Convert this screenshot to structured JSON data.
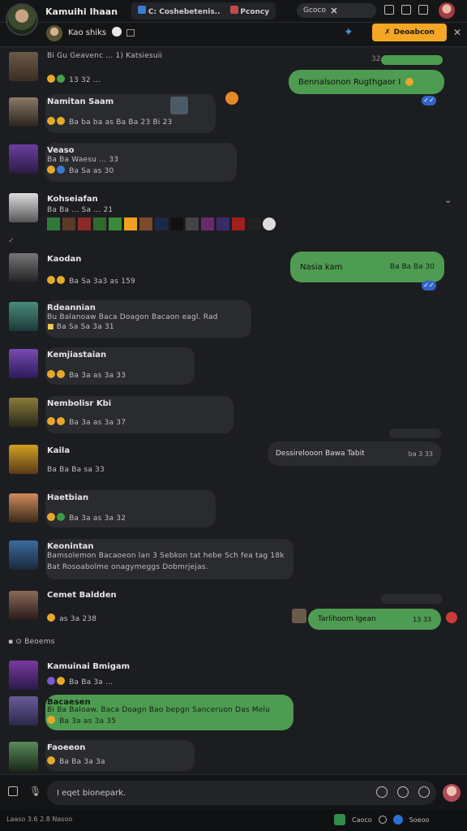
{
  "app": {
    "title": "Kamuihi Ihaan"
  },
  "tabs": [
    {
      "label": "C: Coshebetenis..",
      "icon": "folder-icon"
    },
    {
      "label": "Pconcy",
      "icon": "window-icon"
    }
  ],
  "search": {
    "label": "Gcoco"
  },
  "chat_header": {
    "name": "Kao shiks",
    "button_label": "Deoabcon"
  },
  "messages": [
    {
      "name": "",
      "subtitle": "Bi Gu Geavenc ... 1) Katsiesuii",
      "meta": "13 32 ..."
    },
    {
      "out_text": "Bennalsonon Rugthgaor I",
      "out_time": "32"
    },
    {
      "name": "Namitan Saam",
      "meta": "Ba ba ba as Ba Ba 23 Bi 23"
    },
    {
      "name": "Veaso",
      "subtitle": "Ba Ba Waesu ... 33",
      "meta": "Ba Sa as 30"
    },
    {
      "name": "Kohseiafan",
      "subtitle": "Ba Ba ... Sa ... 21"
    },
    {
      "name": "Kaodan",
      "meta": "Ba Sa 3a3 as 159"
    },
    {
      "out_text": "Nasia kam",
      "out_time": "Ba Ba Ba 30"
    },
    {
      "name": "Rdeannian",
      "subtitle": "Bu Balanoaw Baca Doagon Bacaon eagl. Rad",
      "meta": "Ba Sa Sa 3a 31"
    },
    {
      "name": "Kemjiastaian",
      "meta": "Ba 3a as 3a 33"
    },
    {
      "name": "Nembolisr Kbi",
      "meta": "Ba 3a as 3a 37"
    },
    {
      "out_text": "Dessirelooon Bawa Tabit",
      "out_time": "ba 3 33"
    },
    {
      "name": "Kaila",
      "subtitle": "Ba Ba Ba sa 33"
    },
    {
      "name": "Haetbian",
      "meta": "Ba 3a as 3a 32"
    },
    {
      "name": "Keonintan",
      "subtitle": "Bamsolemon Bacaoeon lan 3 Sebkon tat hebe Sch fea tag 18k",
      "subtitle2": "Bat Rosoabolme onagymeggs Dobmrjejas."
    },
    {
      "name": "Cemet Baldden",
      "meta": "as 3a 238"
    },
    {
      "out_text": "Tarlihoom Igean",
      "out_time": "13 33"
    },
    {
      "name": "Beoems",
      "system": true
    },
    {
      "name": "Kamuinai Bmigam",
      "meta": "Ba Ba 3a ..."
    },
    {
      "name": "Bacaesen",
      "subtitle": "Bi Ba Baloaw. Baca Doagn Bao bepgn Sanceruon Das Melu",
      "meta": "Ba 3a as 3a 35"
    },
    {
      "name": "Faoeeon",
      "meta": "Ba Ba 3a 3a"
    }
  ],
  "composer": {
    "placeholder": "I eqet bionepark."
  },
  "statusbar": {
    "left": "Laaso 3.6 2.8 Nasoo",
    "right1": "Caoco",
    "right2": "Soeoo"
  },
  "colors": {
    "accent": "#f5a623",
    "green_bubble": "#4e9b52",
    "bg": "#1c1d20",
    "incoming": "#2a2b2f",
    "blue": "#3564c8"
  }
}
